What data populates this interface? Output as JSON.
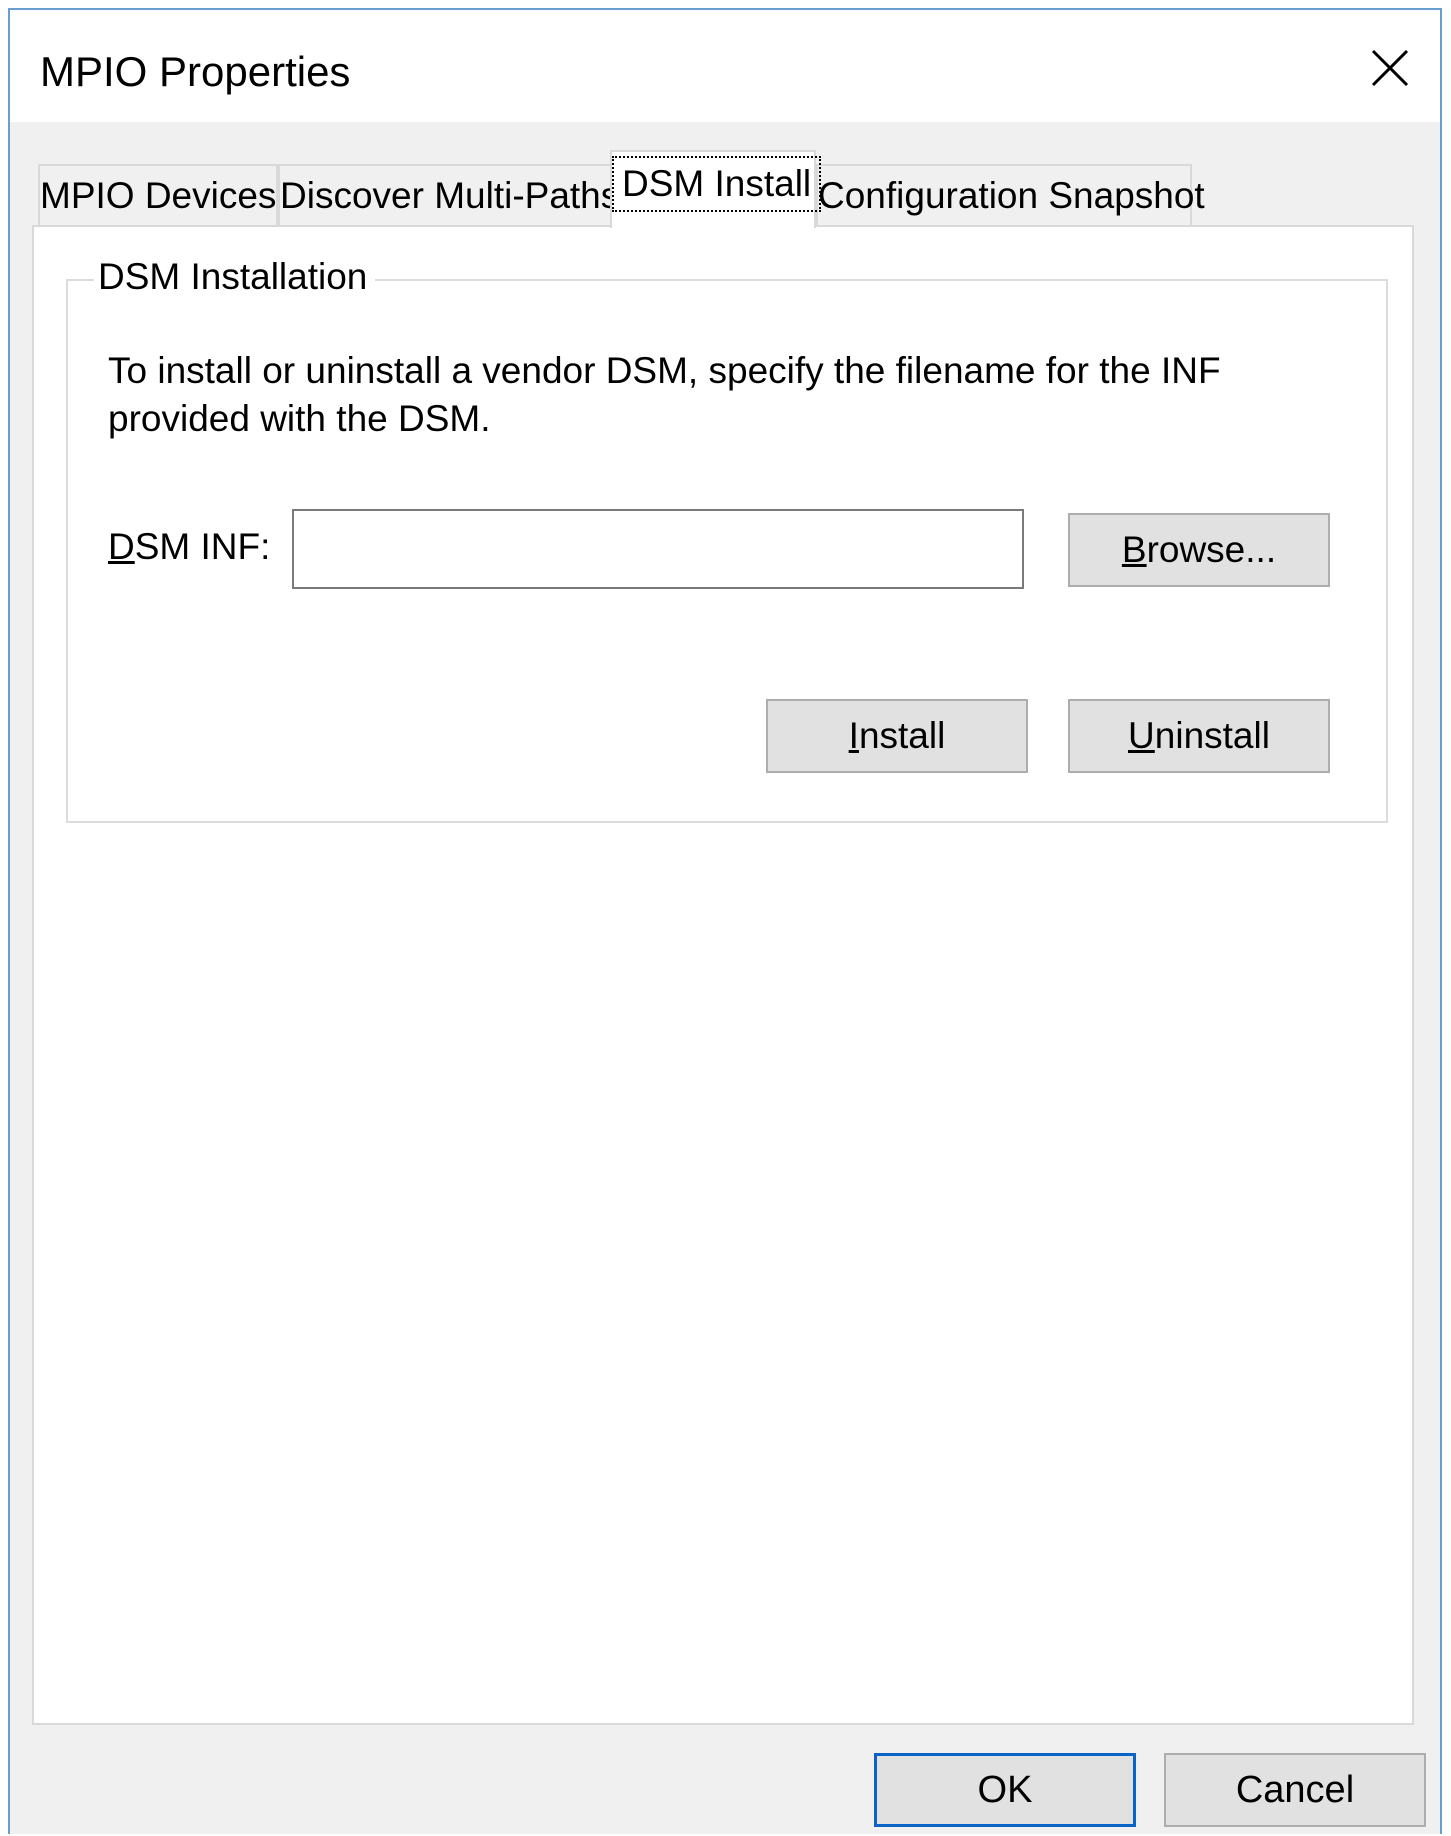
{
  "window": {
    "title": "MPIO Properties"
  },
  "tabs": [
    {
      "label": "MPIO Devices",
      "active": false
    },
    {
      "label": "Discover Multi-Paths",
      "active": false
    },
    {
      "label": "DSM Install",
      "active": true
    },
    {
      "label": "Configuration Snapshot",
      "active": false
    }
  ],
  "group": {
    "legend": "DSM Installation",
    "description": "To install or uninstall a vendor DSM, specify the filename for the INF provided with the DSM.",
    "inf_label_accel": "D",
    "inf_label_rest": "SM INF:",
    "inf_value": "",
    "browse": {
      "accel": "B",
      "rest": "rowse..."
    },
    "install": {
      "accel": "I",
      "rest": "nstall"
    },
    "uninstall": {
      "accel": "U",
      "rest": "ninstall"
    }
  },
  "footer": {
    "ok_label": "OK",
    "cancel_label": "Cancel"
  },
  "colors": {
    "window_border": "#6a9ed3",
    "default_button_border": "#0a64c8",
    "dialog_background": "#f0f0f0"
  }
}
